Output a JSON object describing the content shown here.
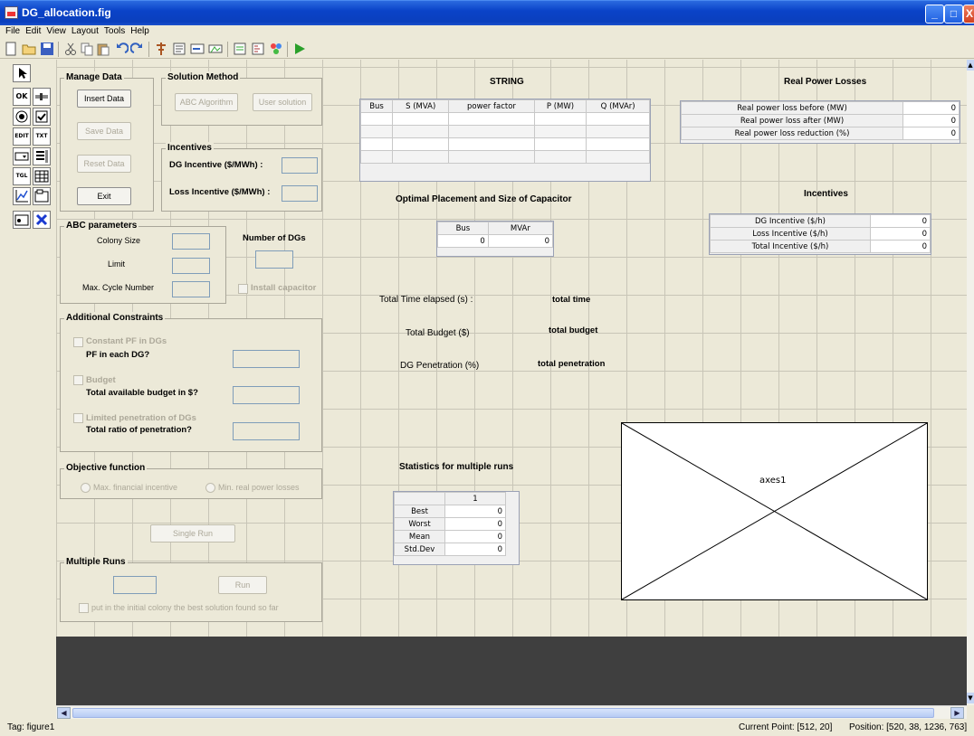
{
  "window": {
    "title": "DG_allocation.fig",
    "buttons": [
      "_",
      "□",
      "X"
    ]
  },
  "menu": [
    "File",
    "Edit",
    "View",
    "Layout",
    "Tools",
    "Help"
  ],
  "toolbar_icons": [
    "new-file-icon",
    "open-folder-icon",
    "save-icon",
    "cut-icon",
    "copy-icon",
    "paste-icon",
    "undo-icon",
    "redo-icon",
    "align-icon",
    "menu-editor-icon",
    "tab-order-icon",
    "toolbar-editor-icon",
    "mfile-editor-icon",
    "property-inspector-icon",
    "object-browser-icon",
    "run-icon"
  ],
  "palette": [
    "select-arrow-icon",
    "push-button-icon",
    "slider-icon",
    "radio-button-icon",
    "checkbox-icon",
    "edit-text-icon",
    "static-text-icon",
    "popup-menu-icon",
    "listbox-icon",
    "toggle-button-icon",
    "table-icon",
    "axes-icon",
    "panel-icon",
    "button-group-icon",
    "activex-icon"
  ],
  "palette_text": {
    "ok": "OK",
    "edit": "EDIT",
    "txt": "TXT",
    "tgl": "TGL"
  },
  "manage_data": {
    "title": "Manage Data",
    "insert": "Insert Data",
    "save": "Save Data",
    "reset": "Reset Data",
    "exit": "Exit"
  },
  "solution_method": {
    "title": "Solution Method",
    "abc": "ABC Algorithm",
    "user": "User solution"
  },
  "incentives_panel": {
    "title": "Incentives",
    "dg": "DG Incentive ($/MWh) :",
    "loss": "Loss Incentive ($/MWh) :"
  },
  "abc_params": {
    "title": "ABC parameters",
    "colony": "Colony Size",
    "limit": "Limit",
    "maxcycle": "Max. Cycle Number"
  },
  "number_of_dgs": "Number of DGs",
  "install_capacitor": "Install capacitor",
  "constraints": {
    "title": "Additional Constraints",
    "pf_check": "Constant PF in DGs",
    "pf_label": "PF in each DG?",
    "budget_check": "Budget",
    "budget_label": "Total available budget in $?",
    "pen_check": "Limited penetration of DGs",
    "pen_label": "Total ratio of penetration?"
  },
  "objective": {
    "title": "Objective function",
    "opt1": "Max. financial incentive",
    "opt2": "Min. real power losses"
  },
  "single_run": "Single Run",
  "multiple_runs": {
    "title": "Multiple Runs",
    "run": "Run",
    "check": "put in the initial colony the best solution found so far"
  },
  "string_table": {
    "title": "STRING",
    "headers": [
      "Bus",
      "S (MVA)",
      "power factor",
      "P (MW)",
      "Q (MVAr)"
    ],
    "rows": [
      [
        "",
        "",
        "",
        "",
        ""
      ],
      [
        "",
        "",
        "",
        "",
        ""
      ],
      [
        "",
        "",
        "",
        "",
        ""
      ],
      [
        "",
        "",
        "",
        "",
        ""
      ]
    ]
  },
  "capacitor": {
    "title": "Optimal Placement and Size of Capacitor",
    "headers": [
      "Bus",
      "MVAr"
    ],
    "values": [
      "0",
      "0"
    ]
  },
  "summary": {
    "time_label": "Total Time elapsed (s) :",
    "time_value": "total time",
    "budget_label": "Total Budget ($)",
    "budget_value": "total budget",
    "pen_label": "DG Penetration (%)",
    "pen_value": "total penetration"
  },
  "stats": {
    "title": "Statistics for multiple runs",
    "col": "1",
    "rows": [
      {
        "label": "Best",
        "value": "0"
      },
      {
        "label": "Worst",
        "value": "0"
      },
      {
        "label": "Mean",
        "value": "0"
      },
      {
        "label": "Std.Dev",
        "value": "0"
      }
    ]
  },
  "losses": {
    "title": "Real Power Losses",
    "rows": [
      {
        "label": "Real power loss before (MW)",
        "value": "0"
      },
      {
        "label": "Real power loss after (MW)",
        "value": "0"
      },
      {
        "label": "Real power loss reduction (%)",
        "value": "0"
      }
    ]
  },
  "incentives_table": {
    "title": "Incentives",
    "rows": [
      {
        "label": "DG Incentive ($/h)",
        "value": "0"
      },
      {
        "label": "Loss Incentive ($/h)",
        "value": "0"
      },
      {
        "label": "Total Incentive ($/h)",
        "value": "0"
      }
    ]
  },
  "axes_label": "axes1",
  "status": {
    "tag": "Tag: figure1",
    "current_point": "Current Point:  [512, 20]",
    "position": "Position: [520, 38, 1236, 763]"
  }
}
